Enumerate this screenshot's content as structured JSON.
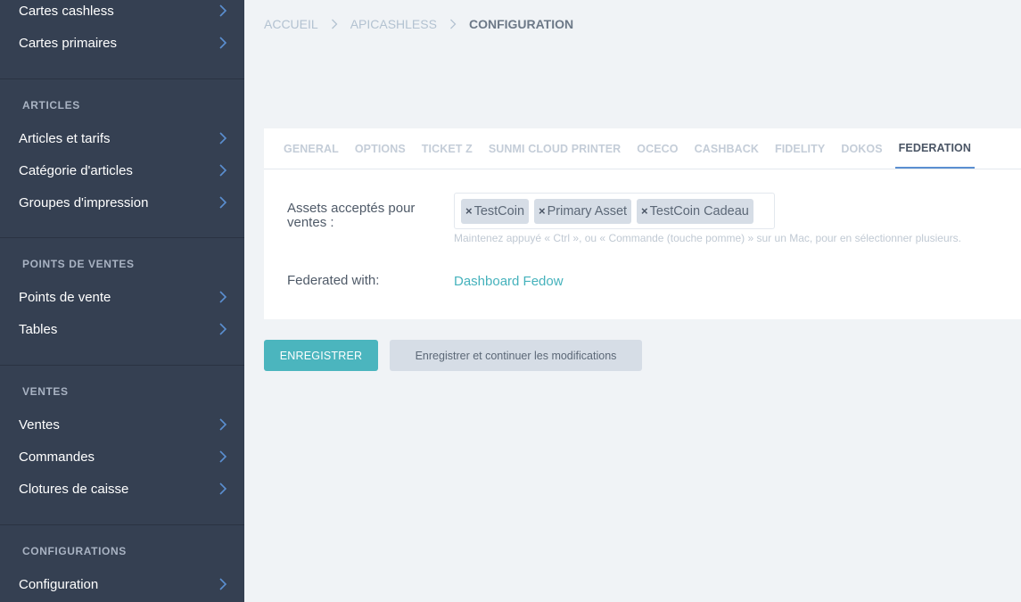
{
  "sidebar": {
    "top_items": [
      {
        "label": "Cartes cashless"
      },
      {
        "label": "Cartes primaires"
      }
    ],
    "sections": [
      {
        "heading": "ARTICLES",
        "items": [
          {
            "label": "Articles et tarifs"
          },
          {
            "label": "Catégorie d'articles"
          },
          {
            "label": "Groupes d'impression"
          }
        ]
      },
      {
        "heading": "POINTS DE VENTES",
        "items": [
          {
            "label": "Points de vente"
          },
          {
            "label": "Tables"
          }
        ]
      },
      {
        "heading": "VENTES",
        "items": [
          {
            "label": "Ventes"
          },
          {
            "label": "Commandes"
          },
          {
            "label": "Clotures de caisse"
          }
        ]
      },
      {
        "heading": "CONFIGURATIONS",
        "items": [
          {
            "label": "Configuration"
          }
        ]
      }
    ]
  },
  "breadcrumb": {
    "home": "ACCUEIL",
    "app": "APICASHLESS",
    "current": "CONFIGURATION"
  },
  "tabs": [
    "GENERAL",
    "OPTIONS",
    "TICKET Z",
    "SUNMI CLOUD PRINTER",
    "OCECO",
    "CASHBACK",
    "FIDELITY",
    "DOKOS",
    "FEDERATION"
  ],
  "active_tab": "FEDERATION",
  "form": {
    "assets_label": "Assets acceptés pour ventes :",
    "assets": [
      "TestCoin",
      "Primary Asset",
      "TestCoin Cadeau"
    ],
    "remove_glyph": "×",
    "help_text": "Maintenez appuyé « Ctrl », ou « Commande (touche pomme) » sur un Mac, pour en sélectionner plusieurs.",
    "federated_label": "Federated with:",
    "federated_link": "Dashboard Fedow"
  },
  "buttons": {
    "save": "ENREGISTRER",
    "save_continue": "Enregistrer et continuer les modifications"
  },
  "colors": {
    "sidebar_bg": "#354052",
    "accent": "#4bb5be",
    "chevron": "#5b8fd1"
  }
}
